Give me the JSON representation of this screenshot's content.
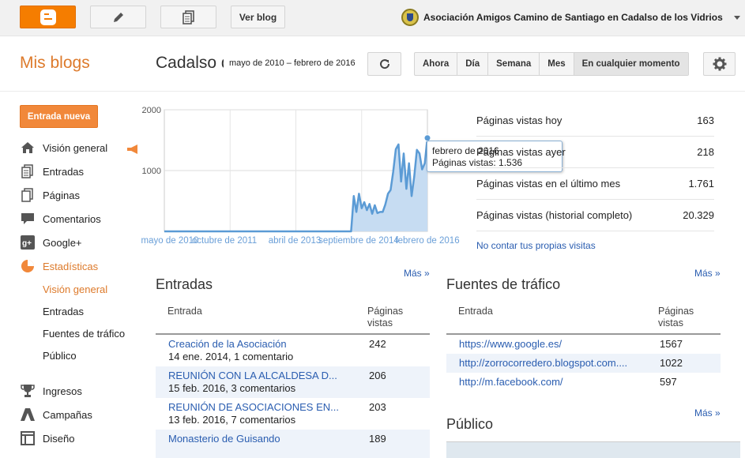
{
  "topbar": {
    "view_blog_label": "Ver blog",
    "blog_name": "Asociación Amigos Camino de Santiago en Cadalso de los Vidrios"
  },
  "header": {
    "my_blogs": "Mis blogs",
    "blog_title": "Cadalso de los Vidrios",
    "date_range": "mayo de 2010 – febrero de 2016",
    "range_buttons": [
      "Ahora",
      "Día",
      "Semana",
      "Mes",
      "En cualquier momento"
    ],
    "selected_range": "En cualquier momento"
  },
  "sidebar": {
    "new_post_label": "Entrada nueva",
    "items": [
      {
        "label": "Visión general",
        "icon": "home-icon"
      },
      {
        "label": "Entradas",
        "icon": "posts-icon"
      },
      {
        "label": "Páginas",
        "icon": "pages-icon"
      },
      {
        "label": "Comentarios",
        "icon": "comment-icon"
      },
      {
        "label": "Google+",
        "icon": "google-plus-icon"
      },
      {
        "label": "Estadísticas",
        "icon": "pie-chart-icon"
      },
      {
        "label": "Ingresos",
        "icon": "trophy-icon"
      },
      {
        "label": "Campañas",
        "icon": "campaign-icon"
      },
      {
        "label": "Diseño",
        "icon": "layout-icon"
      }
    ],
    "sub_items": [
      "Visión general",
      "Entradas",
      "Fuentes de tráfico",
      "Público"
    ]
  },
  "chart_data": {
    "type": "area",
    "x_tick_labels": [
      "mayo de 2010",
      "octubre de 2011",
      "abril de 2013",
      "septiembre de 2014",
      "febrero de 2016"
    ],
    "y_tick_labels": [
      "1000",
      "2000"
    ],
    "ylim": [
      0,
      2000
    ],
    "grid": true,
    "accent_color": "#5b9bd5",
    "values": [
      0,
      0,
      0,
      0,
      0,
      0,
      0,
      0,
      0,
      0,
      0,
      0,
      0,
      0,
      0,
      0,
      0,
      0,
      0,
      0,
      0,
      0,
      0,
      0,
      0,
      0,
      0,
      0,
      0,
      0,
      0,
      0,
      0,
      0,
      0,
      0,
      0,
      0,
      0,
      0,
      0,
      0,
      0,
      0,
      0,
      0,
      0,
      0,
      0,
      0,
      0,
      0,
      0,
      0,
      0,
      0,
      0,
      0,
      0,
      0,
      0,
      0,
      0,
      0,
      0,
      0,
      0,
      0,
      0,
      0,
      0,
      0,
      580,
      320,
      620,
      380,
      480,
      350,
      450,
      290,
      430,
      300,
      320,
      320,
      440,
      620,
      680,
      980,
      1350,
      1430,
      820,
      1280,
      700,
      1120,
      580,
      900,
      1340,
      1280,
      1020,
      1120,
      1536
    ],
    "tooltip": {
      "title": "febrero de 2016",
      "label": "Páginas vistas: 1.536"
    }
  },
  "stats": [
    {
      "label": "Páginas vistas hoy",
      "value": "163"
    },
    {
      "label": "Páginas vistas ayer",
      "value": "218"
    },
    {
      "label": "Páginas vistas en el último mes",
      "value": "1.761"
    },
    {
      "label": "Páginas vistas (historial completo)",
      "value": "20.329"
    }
  ],
  "no_count_link": "No contar tus propias visitas",
  "entries": {
    "title": "Entradas",
    "more": "Más »",
    "col_entry": "Entrada",
    "col_views_1": "Páginas",
    "col_views_2": "vistas",
    "rows": [
      {
        "title": "Creación de la Asociación",
        "meta": "14 ene. 2014, 1 comentario",
        "views": "242"
      },
      {
        "title": "REUNIÓN CON LA ALCALDESA D...",
        "meta": "15 feb. 2016, 3 comentarios",
        "views": "206"
      },
      {
        "title": "REUNIÓN DE ASOCIACIONES EN...",
        "meta": "13 feb. 2016, 7 comentarios",
        "views": "203"
      },
      {
        "title": "Monasterio de Guisando",
        "meta": "",
        "views": "189"
      }
    ]
  },
  "traffic": {
    "title": "Fuentes de tráfico",
    "more": "Más »",
    "col_entry": "Entrada",
    "col_views_1": "Páginas",
    "col_views_2": "vistas",
    "rows": [
      {
        "url": "https://www.google.es/",
        "views": "1567"
      },
      {
        "url": "http://zorrocorredero.blogspot.com....",
        "views": "1022"
      },
      {
        "url": "http://m.facebook.com/",
        "views": "597"
      }
    ]
  },
  "audience": {
    "title": "Público",
    "more": "Más »"
  }
}
